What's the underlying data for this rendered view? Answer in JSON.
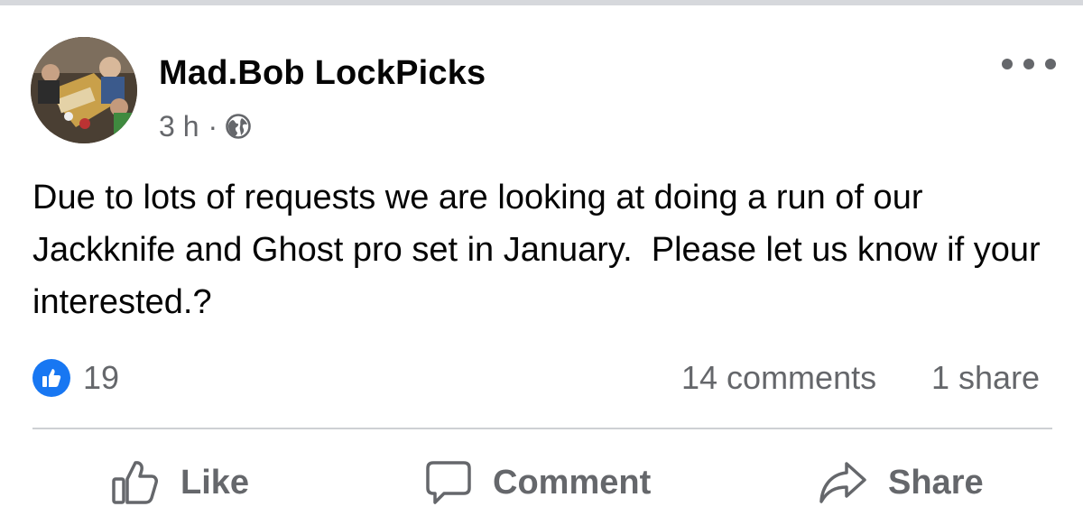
{
  "post": {
    "author": "Mad.Bob LockPicks",
    "time": "3 h",
    "separator": "·",
    "audience_icon": "globe-icon",
    "text": "Due to lots of requests we are looking at doing a run of our Jackknife and Ghost pro set in January.  Please let us know if your interested.?",
    "more_icon": "more-horizontal-icon"
  },
  "stats": {
    "reaction_icon": "thumbs-up-icon",
    "reaction_count": "19",
    "comments": "14 comments",
    "shares": "1 share"
  },
  "actions": {
    "like_label": "Like",
    "comment_label": "Comment",
    "share_label": "Share"
  },
  "colors": {
    "accent": "#1877f2",
    "secondary_text": "#65676b",
    "primary_text": "#050505",
    "divider": "#ced0d4"
  }
}
